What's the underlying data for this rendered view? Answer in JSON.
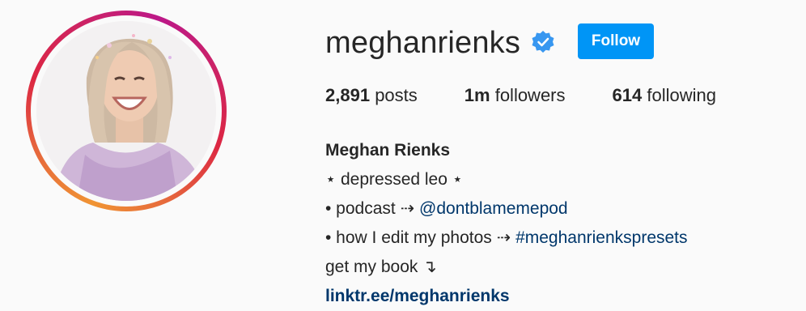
{
  "profile": {
    "username": "meghanrienks",
    "verified_icon": "verified-badge-icon",
    "follow_label": "Follow",
    "accent_color": "#0095f6",
    "avatar_icon": "profile-photo"
  },
  "stats": {
    "posts_count": "2,891",
    "posts_label": "posts",
    "followers_count": "1m",
    "followers_label": "followers",
    "following_count": "614",
    "following_label": "following"
  },
  "bio": {
    "full_name": "Meghan Rienks",
    "line1": "⋆ depressed leo ⋆",
    "line2_prefix": "• podcast ⇢ ",
    "line2_mention": "@dontblamemepod",
    "line3_prefix": "• how I edit my photos ⇢ ",
    "line3_hashtag": "#meghanrienkspresets",
    "line4": "get my book ↴",
    "website": "linktr.ee/meghanrienks"
  }
}
